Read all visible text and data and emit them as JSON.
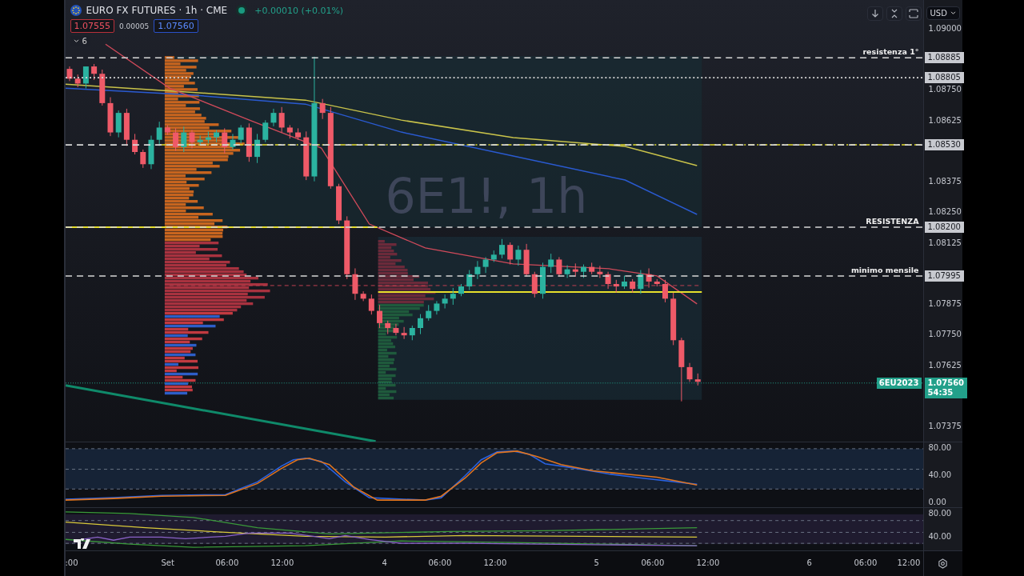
{
  "header": {
    "symbol": "EURO FX FUTURES · 1h · CME",
    "change": "+0.00010 (+0.01%)",
    "bid": "1.07555",
    "spread": "0.00005",
    "ask": "1.07560",
    "indicators_count": "6"
  },
  "toolbar": {
    "currency": "USD"
  },
  "watermark": {
    "title": "6E1!, 1h"
  },
  "price_axis": [
    "1.09000",
    "1.08750",
    "1.08625",
    "1.08375",
    "1.08250",
    "1.08125",
    "1.07875",
    "1.07750",
    "1.07625",
    "1.07375"
  ],
  "levels": [
    {
      "label": "resistenza 1°",
      "price": "1.08885"
    },
    {
      "price": "1.08805"
    },
    {
      "price": "1.08530"
    },
    {
      "label": "RESISTENZA",
      "price": "1.08200"
    },
    {
      "label": "minimo mensile",
      "price": "1.07995"
    }
  ],
  "last_price": {
    "symbol": "6EU2023",
    "price": "1.07560",
    "countdown": "54:35"
  },
  "oscillator_axis": [
    "80.00",
    "40.00",
    "0.00"
  ],
  "indicator_axis": [
    "80.00",
    "40.00"
  ],
  "time_axis": [
    ":00",
    "Set",
    "06:00",
    "12:00",
    "4",
    "06:00",
    "12:00",
    "5",
    "06:00",
    "12:00",
    "6",
    "06:00",
    "12:00"
  ]
}
